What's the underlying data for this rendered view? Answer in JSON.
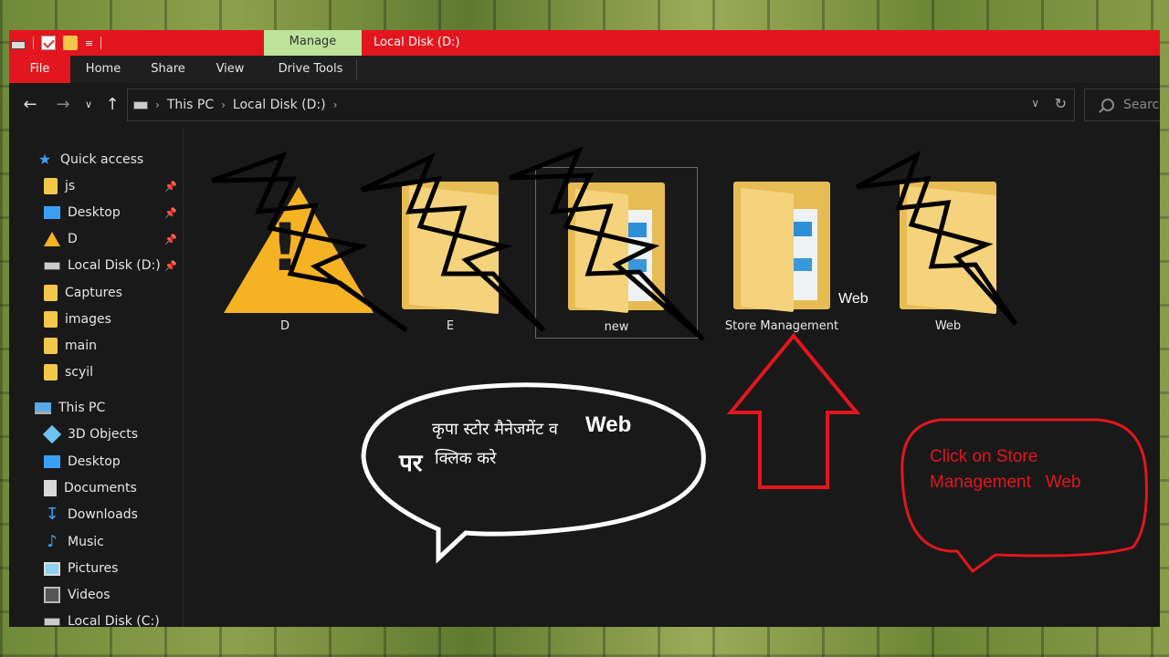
{
  "titlebar": {
    "manage_tab": "Manage",
    "title": "Local Disk (D:)",
    "accent": "#e2161e",
    "manage_color": "#bde39a"
  },
  "ribbon": {
    "tabs": [
      "File",
      "Home",
      "Share",
      "View",
      "Drive Tools"
    ]
  },
  "navbar": {
    "breadcrumb": [
      "This PC",
      "Local Disk (D:)"
    ],
    "search_placeholder": "Search"
  },
  "sidebar": {
    "quick_access": "Quick access",
    "pinned": [
      {
        "label": "js",
        "icon": "folder-icon"
      },
      {
        "label": "Desktop",
        "icon": "desktop-icon"
      },
      {
        "label": "D",
        "icon": "warning-icon"
      },
      {
        "label": "Local Disk (D:)",
        "icon": "drive-icon"
      }
    ],
    "recent": [
      "Captures",
      "images",
      "main",
      "scyil"
    ],
    "this_pc": "This PC",
    "pc_items": [
      "3D Objects",
      "Desktop",
      "Documents",
      "Downloads",
      "Music",
      "Pictures",
      "Videos",
      "Local Disk (C:)"
    ]
  },
  "files": [
    {
      "name": "D",
      "icon": "warning-icon"
    },
    {
      "name": "E",
      "icon": "folder-icon"
    },
    {
      "name": "new",
      "icon": "folder-with-documents-icon",
      "selected": true
    },
    {
      "name": "Store Management",
      "icon": "folder-with-documents-icon"
    },
    {
      "name": "Web",
      "icon": "folder-icon"
    }
  ],
  "overlay": {
    "web_floating_label": "Web",
    "speech_bubble_line1": "कृपा स्टोर मैनेजमेंट व",
    "speech_bubble_web": "Web",
    "speech_bubble_par": "पर",
    "speech_bubble_line2": "क्लिक करे",
    "red_note_line1": "Click on Store",
    "red_note_line2": "Management   Web",
    "annotation_color": "#e2161e"
  }
}
